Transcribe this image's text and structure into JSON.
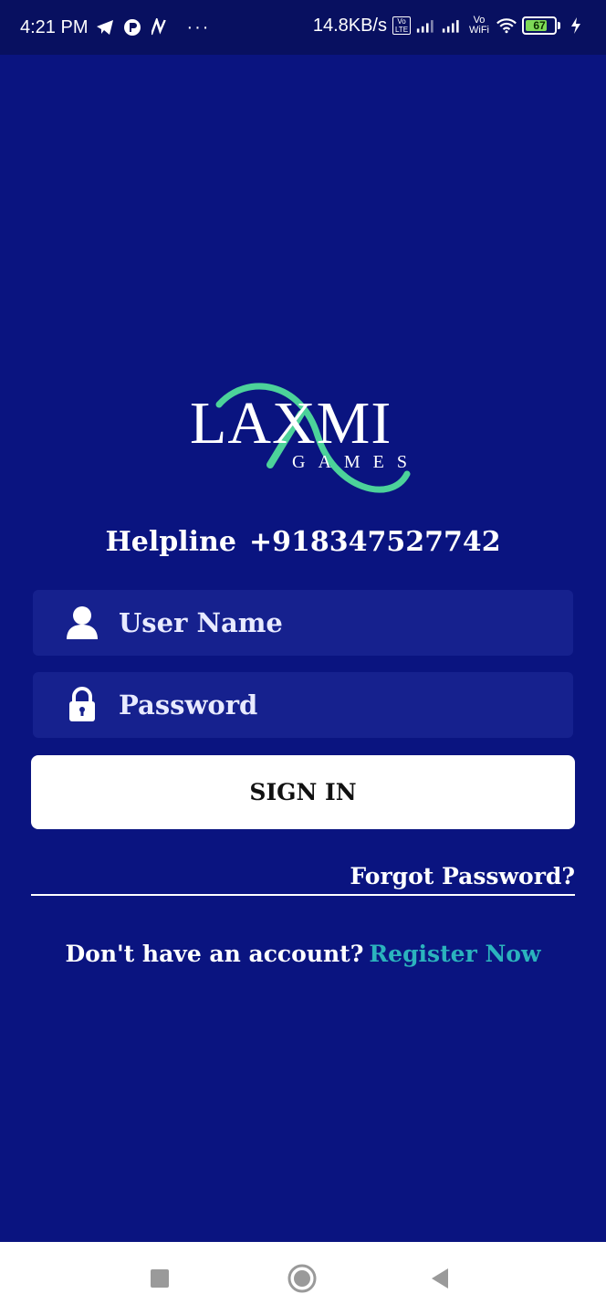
{
  "status_bar": {
    "time": "4:21 PM",
    "icons_left": [
      "telegram-icon",
      "app-icon",
      "n-app-icon",
      "more-dots-icon"
    ],
    "more": "···",
    "net_speed": "14.8KB/s",
    "volte": "Vo LTE",
    "vowifi": "Vo WiFi",
    "battery": "67"
  },
  "logo": {
    "brand": "LAXMI",
    "sub": "GAMES",
    "accent_color": "#4cd29a"
  },
  "helpline": {
    "label": "Helpline",
    "number": "+918347527742"
  },
  "form": {
    "username_placeholder": "User Name",
    "password_placeholder": "Password",
    "sign_in_label": "SIGN IN",
    "forgot_label": "Forgot Password?"
  },
  "register": {
    "prompt": "Don't have an account?",
    "link": "Register Now"
  },
  "colors": {
    "background": "#0a1480",
    "field": "#16218e",
    "link": "#2bb3bd"
  }
}
